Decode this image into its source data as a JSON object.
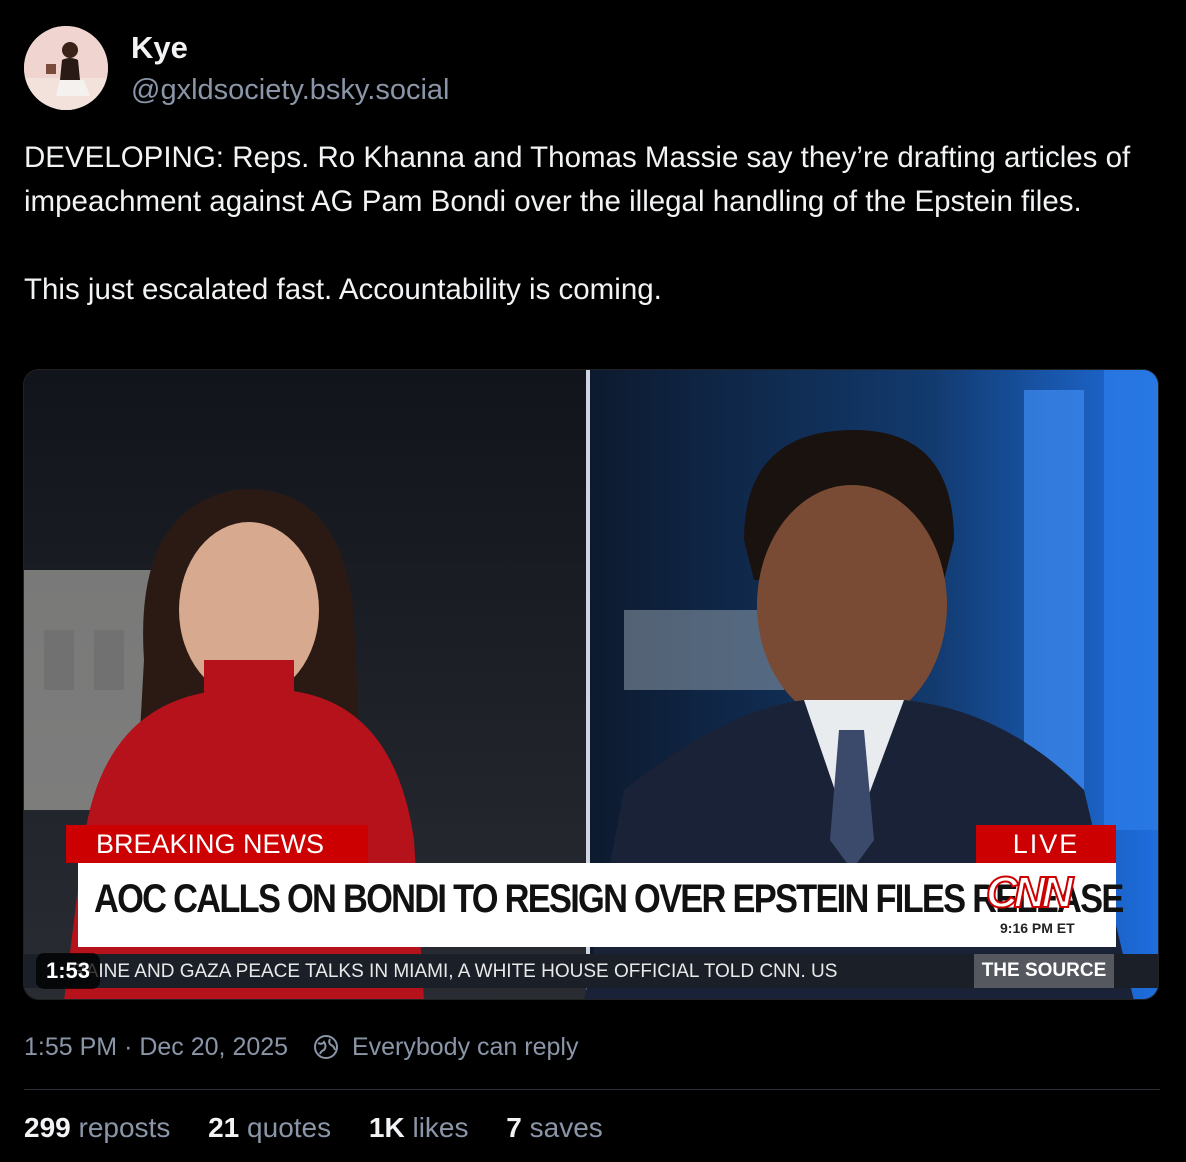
{
  "author": {
    "name": "Kye",
    "handle": "@gxldsociety.bsky.social"
  },
  "post": {
    "text": "DEVELOPING: Reps. Ro Khanna and Thomas Massie say they’re drafting articles of impeachment against AG Pam Bondi over the illegal handling of the Epstein files.\n\nThis just escalated fast. Accountability is coming."
  },
  "video": {
    "duration": "1:53",
    "breaking_label": "BREAKING NEWS",
    "live_label": "LIVE",
    "headline": "AOC CALLS ON BONDI TO RESIGN OVER EPSTEIN FILES RELEASE",
    "network": "CNN",
    "time": "9:16 PM ET",
    "ticker": "RAINE AND GAZA PEACE TALKS IN MIAMI, A WHITE HOUSE OFFICIAL TOLD CNN. US",
    "show": "THE SOURCE"
  },
  "meta": {
    "time": "1:55 PM",
    "separator": "·",
    "date": "Dec 20, 2025",
    "reply_setting": "Everybody can reply"
  },
  "stats": [
    {
      "count": "299",
      "label": "reposts"
    },
    {
      "count": "21",
      "label": "quotes"
    },
    {
      "count": "1K",
      "label": "likes"
    },
    {
      "count": "7",
      "label": "saves"
    }
  ],
  "colors": {
    "background": "#000000",
    "text": "#f1f3f5",
    "muted": "#8a96a8",
    "cnn_red": "#cc0000"
  }
}
